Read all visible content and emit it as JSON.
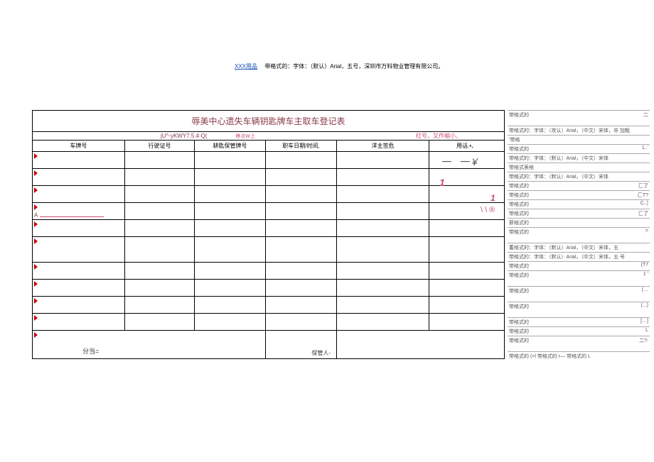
{
  "header": {
    "link": "XXX用品",
    "text": "带格式的：字体：（默认）Arial，五号，深圳市万科物业管理有限公司。"
  },
  "title": "辱美中心遗失车辆钥匙牌车主取车登记表",
  "code": "jU^-yKWY7.5.4-Q(",
  "code_mid": "移点W上",
  "code_right": "红号，又作缩小、",
  "columns": {
    "c1": "车牌号",
    "c2": "行驶证号",
    "c3": "耕匙保管牌号",
    "c4": "职车日期/时间,",
    "c5": "洋主签危",
    "c6": "用话.•、"
  },
  "scribbles": {
    "s1": "一 一¥",
    "s2": "1",
    "s3": "1",
    "s4": "\\ \\ ®"
  },
  "row_a": "A",
  "bottom": {
    "label1": "分当=",
    "label2": "保管人-"
  },
  "side": [
    {
      "l": "带格式的",
      "r": "二"
    },
    {
      "l": "带格式的：字体：（攻认）Arial，（中文）宋体，非 加粗",
      "r": ""
    },
    {
      "l": "'带格",
      "r": ""
    },
    {
      "l": "带格式的",
      "r": "1..'"
    },
    {
      "l": "带格式的：字体：（默认）Arial，（中文）宋体",
      "r": ""
    },
    {
      "l": "带格式表格",
      "r": ""
    },
    {
      "l": "带格式的：字体：（默认）Arial，（中文）宋体",
      "r": ""
    },
    {
      "l": "带格式的",
      "r": "匚了"
    },
    {
      "l": "带格式的",
      "r": "匚T?"
    },
    {
      "l": "带格式的",
      "r": "C..)"
    },
    {
      "l": "带格式的",
      "r": "匚了"
    },
    {
      "l": "薪格式的",
      "r": ""
    },
    {
      "l": "带格式的",
      "r": "="
    },
    {
      "l": "蓄格式的：字体：（默认）Arial，（中文）宋体，五",
      "r": ""
    },
    {
      "l": "带格式的：字体：（默认）Arial，（中文）宋体，五 号",
      "r": ""
    },
    {
      "l": "带格式的",
      "r": "(T7"
    },
    {
      "l": "带格式的",
      "r": "1 '"
    },
    {
      "l": "带格式的",
      "r": "(…"
    },
    {
      "l": "带格式的",
      "r": "(...)"
    },
    {
      "l": "带格式的",
      "r": "[…]"
    },
    {
      "l": "带格式的",
      "r": "L"
    },
    {
      "l": "带格式的",
      "r": "二?:"
    },
    {
      "l": "带格式的 (=l 带格式的 r— 带格式的 L",
      "r": ""
    }
  ]
}
